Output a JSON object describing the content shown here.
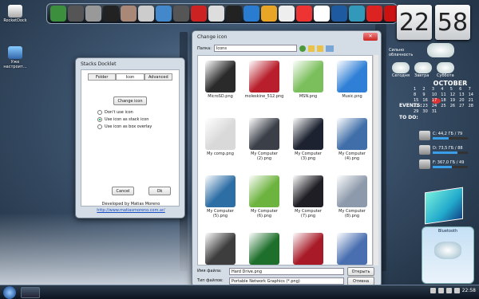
{
  "desktop": {
    "icons": [
      {
        "label": "RocketDock"
      },
      {
        "label": "Уже настроит..."
      }
    ]
  },
  "clock": {
    "hours": "22",
    "minutes": "58"
  },
  "weather": {
    "current": "Сильно облачность",
    "days": [
      "Сегодня",
      "Завтра",
      "Суббота"
    ]
  },
  "calendar": {
    "month": "OCTOBER",
    "events_label": "EVENTS:",
    "todo_label": "TO DO:",
    "days": [
      "1",
      "2",
      "3",
      "4",
      "5",
      "6",
      "7",
      "8",
      "9",
      "10",
      "11",
      "12",
      "13",
      "14",
      "15",
      "16",
      "17",
      "18",
      "19",
      "20",
      "21",
      "22",
      "23",
      "24",
      "25",
      "26",
      "27",
      "28",
      "29",
      "30",
      "31"
    ],
    "selected_day": "17"
  },
  "drives": [
    {
      "label": "C:",
      "info": "44,2 ГБ / 79",
      "fill": 0.45
    },
    {
      "label": "D:",
      "info": "73,5 ГБ / 88",
      "fill": 0.7
    },
    {
      "label": "F:",
      "info": "367,0 ГБ / 49",
      "fill": 0.55
    }
  ],
  "widget": {
    "title": "Bluetooth"
  },
  "stacks_window": {
    "title": "Stacks Docklet",
    "tabs": [
      "Folder",
      "Icon",
      "Advanced"
    ],
    "change_icon_button": "Change icon",
    "options": [
      "Don't use icon",
      "Use icon as stack icon",
      "Use icon as box overlay"
    ],
    "selected_option": 1,
    "cancel_button": "Cancel",
    "ok_button": "Ok",
    "developer": "Developed by Matias Moreno",
    "link": "http://www.matiasmoreno.com.ar/"
  },
  "change_icon": {
    "title": "Change icon",
    "location_label": "Папка:",
    "location_value": "Icons",
    "items": [
      {
        "name": "MicroSD.png",
        "color": "#2a2a2a"
      },
      {
        "name": "moleskine_512.png",
        "color": "#b81e2b"
      },
      {
        "name": "MSN.png",
        "color": "#7abf5b"
      },
      {
        "name": "Music.png",
        "color": "#2f7fd6"
      },
      {
        "name": "My comp.png",
        "color": "#d9d9d9"
      },
      {
        "name": "My Computer (2).png",
        "color": "#3a3f48"
      },
      {
        "name": "My Computer (3).png",
        "color": "#1c2230"
      },
      {
        "name": "My Computer (4).png",
        "color": "#3f6ea8"
      },
      {
        "name": "My Computer (5).png",
        "color": "#2d6ea5"
      },
      {
        "name": "My Computer (6).png",
        "color": "#6db33f"
      },
      {
        "name": "My Computer (7).png",
        "color": "#1e1e24"
      },
      {
        "name": "My Computer (8).png",
        "color": "#8d9aab"
      },
      {
        "name": "",
        "color": "#3d3d3d"
      },
      {
        "name": "",
        "color": "#1d6f2b"
      },
      {
        "name": "",
        "color": "#a81a27"
      },
      {
        "name": "",
        "color": "#4a6fb0"
      }
    ],
    "filename_label": "Имя файла:",
    "filename_value": "Hard Drive.png",
    "filetype_label": "Тип файлов:",
    "filetype_value": "Portable Network Graphics (*.png)",
    "open_button": "Открыть",
    "cancel_button": "Отмена"
  },
  "taskbar": {
    "time": "22:58"
  }
}
